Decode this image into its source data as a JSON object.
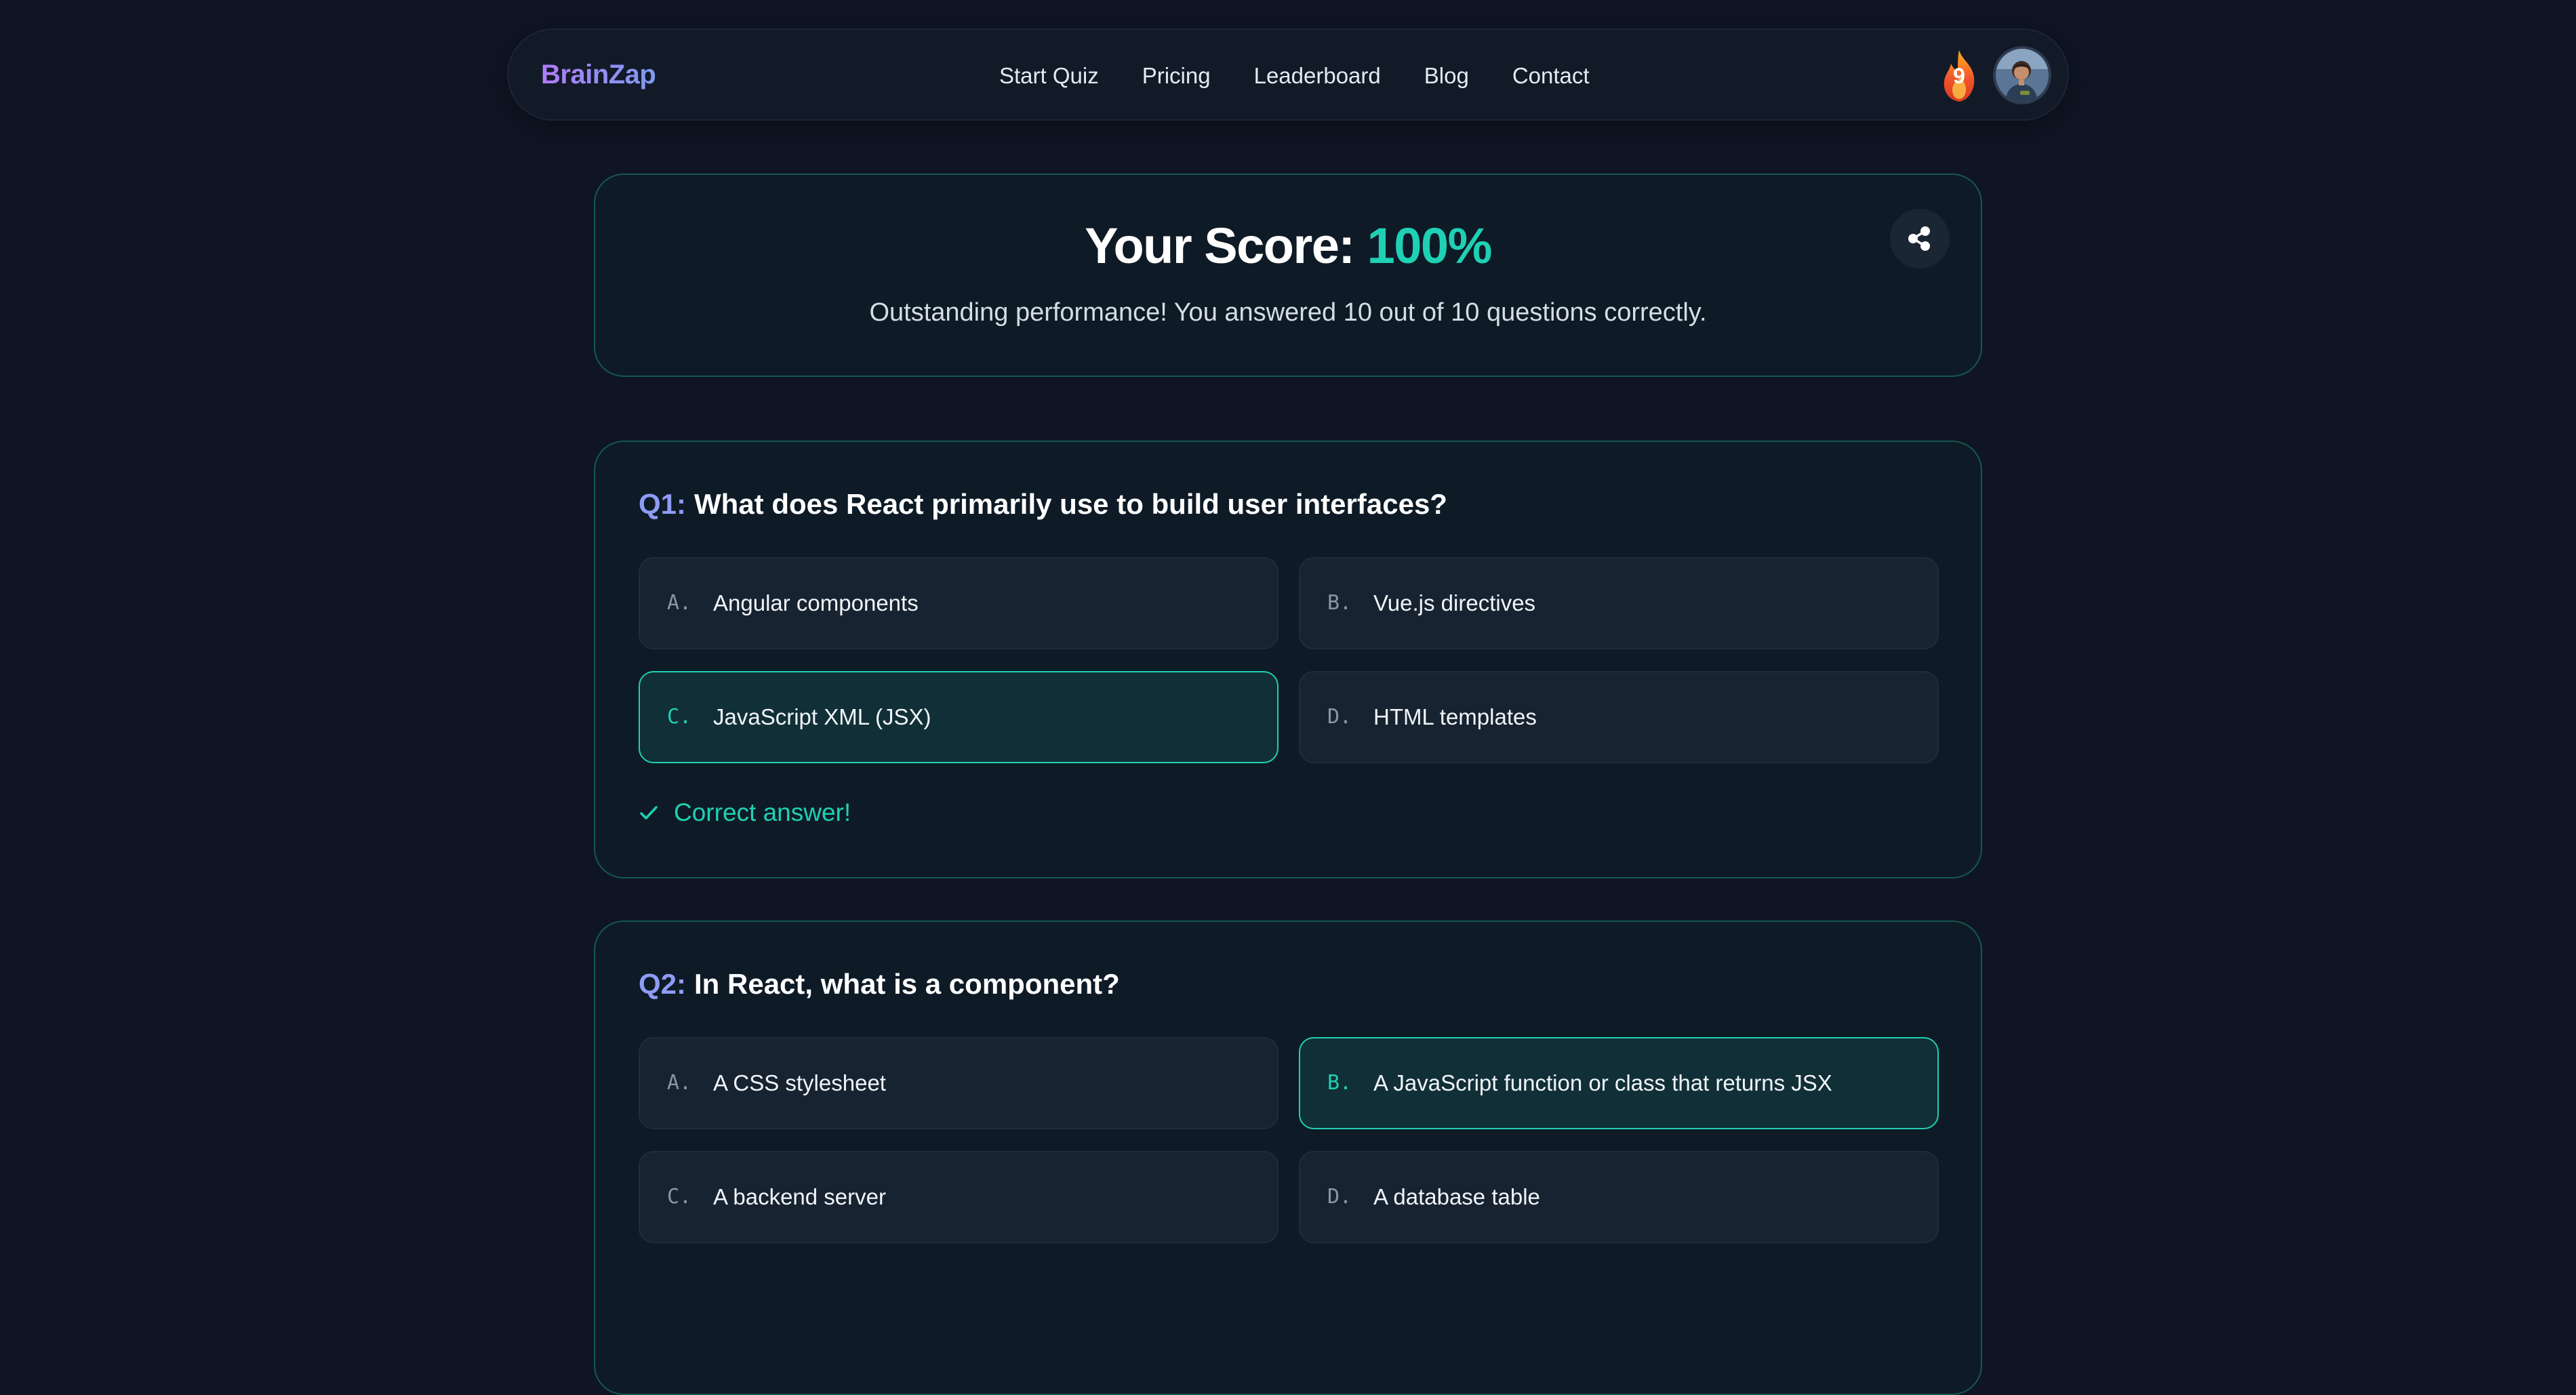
{
  "navbar": {
    "brand": "BrainZap",
    "links": [
      "Start Quiz",
      "Pricing",
      "Leaderboard",
      "Blog",
      "Contact"
    ],
    "streak_count": "9",
    "icons": {
      "streak": "flame-icon",
      "avatar": "user-avatar"
    }
  },
  "score": {
    "label": "Your Score:",
    "value": "100%",
    "message": "Outstanding performance! You answered 10 out of 10 questions correctly.",
    "share_icon": "share-icon"
  },
  "questions": [
    {
      "number": "Q1:",
      "text": "What does React primarily use to build user interfaces?",
      "options": [
        {
          "letter": "A.",
          "text": "Angular components",
          "correct": false
        },
        {
          "letter": "B.",
          "text": "Vue.js directives",
          "correct": false
        },
        {
          "letter": "C.",
          "text": "JavaScript XML (JSX)",
          "correct": true
        },
        {
          "letter": "D.",
          "text": "HTML templates",
          "correct": false
        }
      ],
      "feedback": "Correct answer!",
      "feedback_icon": "checkmark-icon"
    },
    {
      "number": "Q2:",
      "text": "In React, what is a component?",
      "options": [
        {
          "letter": "A.",
          "text": "A CSS stylesheet",
          "correct": false
        },
        {
          "letter": "B.",
          "text": "A JavaScript function or class that returns JSX",
          "correct": true
        },
        {
          "letter": "C.",
          "text": "A backend server",
          "correct": false
        },
        {
          "letter": "D.",
          "text": "A database table",
          "correct": false
        }
      ]
    }
  ],
  "colors": {
    "background": "#0f1524",
    "accent": "#1fd0b4",
    "question_number": "#8f9cf5",
    "card_border": "#15584f"
  }
}
